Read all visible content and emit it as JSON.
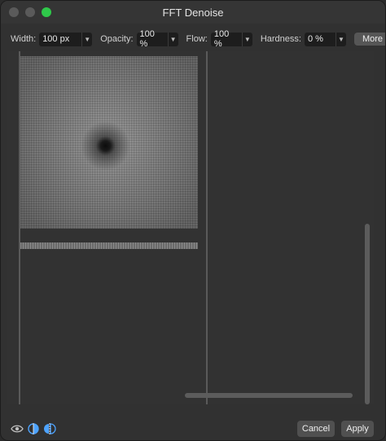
{
  "window": {
    "title": "FFT Denoise"
  },
  "toolbar": {
    "width": {
      "label": "Width:",
      "value": "100 px"
    },
    "opacity": {
      "label": "Opacity:",
      "value": "100 %"
    },
    "flow": {
      "label": "Flow:",
      "value": "100 %"
    },
    "hardness": {
      "label": "Hardness:",
      "value": "0 %"
    },
    "more_label": "More"
  },
  "icons": {
    "view": "eye-icon",
    "split_view": "split-view-icon",
    "mirror_view": "mirror-view-icon"
  },
  "buttons": {
    "cancel": "Cancel",
    "apply": "Apply"
  },
  "colors": {
    "accent_green": "#2fc84a",
    "icon_blue": "#4da3ff"
  }
}
